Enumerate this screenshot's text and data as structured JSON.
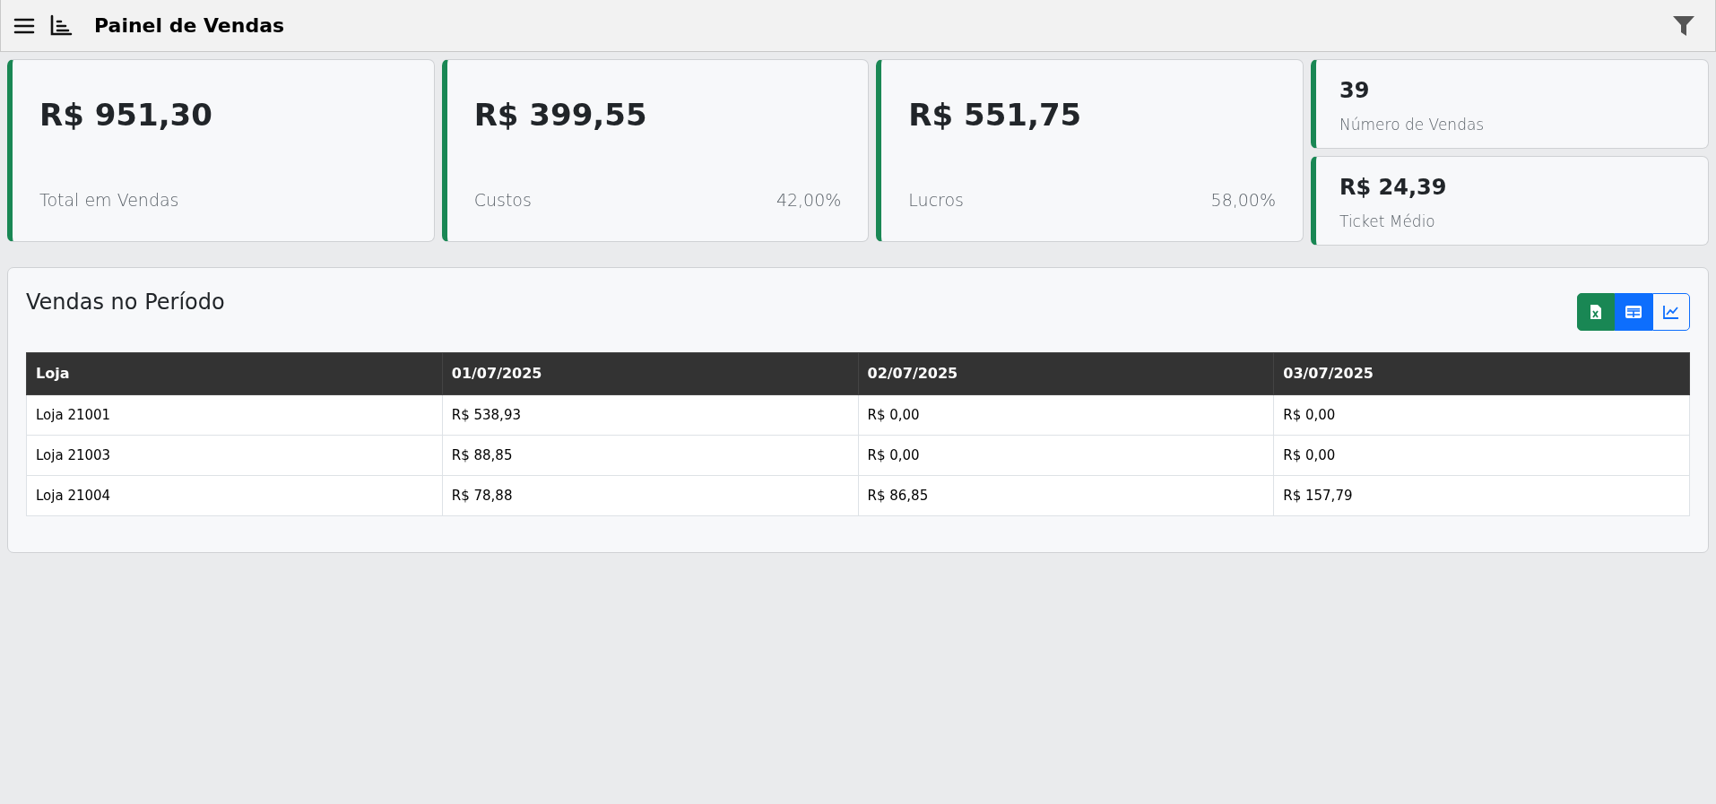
{
  "header": {
    "title": "Painel de Vendas"
  },
  "stats": [
    {
      "value": "R$ 951,30",
      "label": "Total em Vendas"
    },
    {
      "value": "R$ 399,55",
      "label": "Custos",
      "percent": "42,00%"
    },
    {
      "value": "R$ 551,75",
      "label": "Lucros",
      "percent": "58,00%"
    }
  ],
  "small_stats": [
    {
      "value": "39",
      "label": "Número de Vendas"
    },
    {
      "value": "R$ 24,39",
      "label": "Ticket Médio"
    }
  ],
  "section": {
    "title": "Vendas no Período",
    "buttons": [
      {
        "kind": "export"
      },
      {
        "kind": "table",
        "selected": true
      },
      {
        "kind": "chart",
        "selected": false
      }
    ],
    "table": {
      "columns": [
        "Loja",
        "01/07/2025",
        "02/07/2025",
        "03/07/2025"
      ],
      "rows": [
        [
          "Loja 21001",
          "R$ 538,93",
          "R$ 0,00",
          "R$ 0,00"
        ],
        [
          "Loja 21003",
          "R$ 88,85",
          "R$ 0,00",
          "R$ 0,00"
        ],
        [
          "Loja 21004",
          "R$ 78,88",
          "R$ 86,85",
          "R$ 157,79"
        ]
      ]
    }
  }
}
